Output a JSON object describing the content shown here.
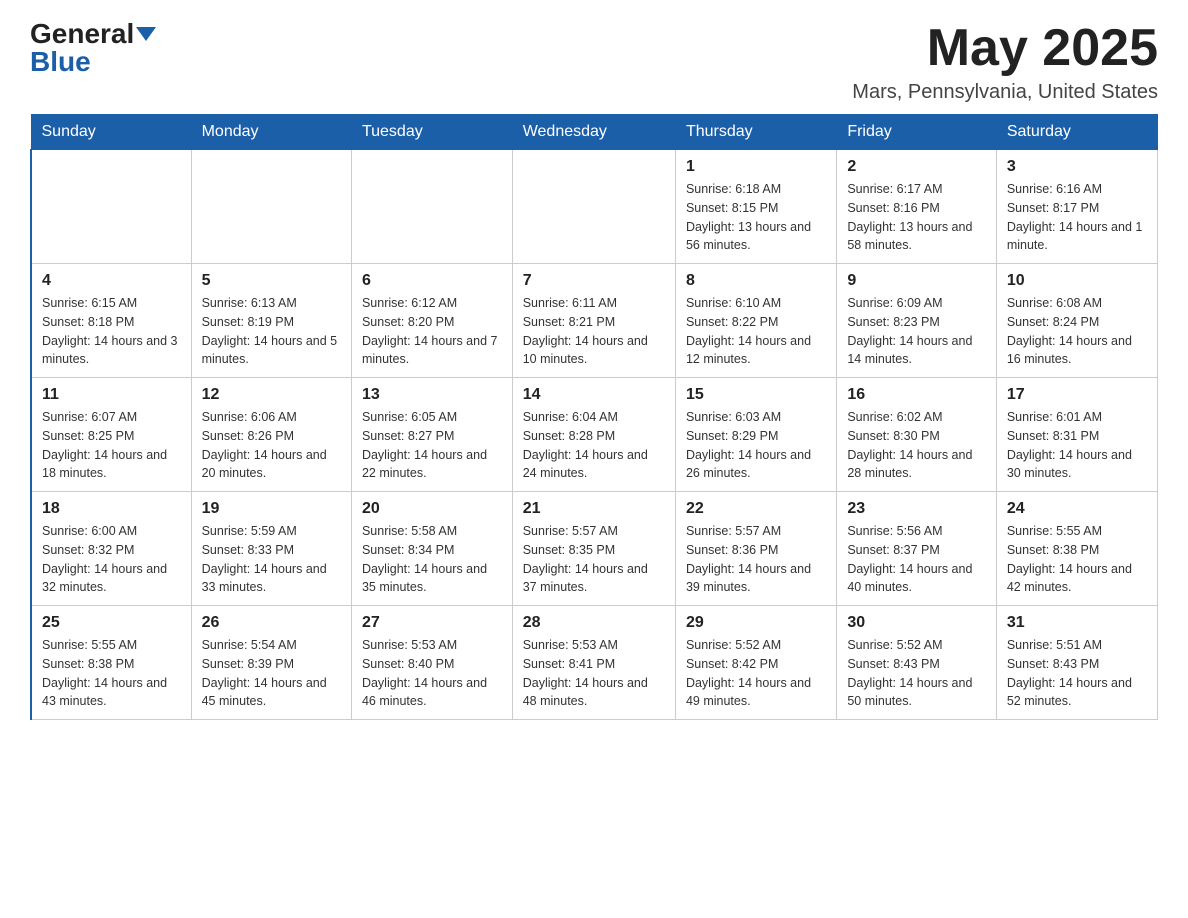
{
  "header": {
    "logo_general": "General",
    "logo_blue": "Blue",
    "title": "May 2025",
    "subtitle": "Mars, Pennsylvania, United States"
  },
  "days_of_week": [
    "Sunday",
    "Monday",
    "Tuesday",
    "Wednesday",
    "Thursday",
    "Friday",
    "Saturday"
  ],
  "weeks": [
    [
      {
        "day": "",
        "info": ""
      },
      {
        "day": "",
        "info": ""
      },
      {
        "day": "",
        "info": ""
      },
      {
        "day": "",
        "info": ""
      },
      {
        "day": "1",
        "info": "Sunrise: 6:18 AM\nSunset: 8:15 PM\nDaylight: 13 hours and 56 minutes."
      },
      {
        "day": "2",
        "info": "Sunrise: 6:17 AM\nSunset: 8:16 PM\nDaylight: 13 hours and 58 minutes."
      },
      {
        "day": "3",
        "info": "Sunrise: 6:16 AM\nSunset: 8:17 PM\nDaylight: 14 hours and 1 minute."
      }
    ],
    [
      {
        "day": "4",
        "info": "Sunrise: 6:15 AM\nSunset: 8:18 PM\nDaylight: 14 hours and 3 minutes."
      },
      {
        "day": "5",
        "info": "Sunrise: 6:13 AM\nSunset: 8:19 PM\nDaylight: 14 hours and 5 minutes."
      },
      {
        "day": "6",
        "info": "Sunrise: 6:12 AM\nSunset: 8:20 PM\nDaylight: 14 hours and 7 minutes."
      },
      {
        "day": "7",
        "info": "Sunrise: 6:11 AM\nSunset: 8:21 PM\nDaylight: 14 hours and 10 minutes."
      },
      {
        "day": "8",
        "info": "Sunrise: 6:10 AM\nSunset: 8:22 PM\nDaylight: 14 hours and 12 minutes."
      },
      {
        "day": "9",
        "info": "Sunrise: 6:09 AM\nSunset: 8:23 PM\nDaylight: 14 hours and 14 minutes."
      },
      {
        "day": "10",
        "info": "Sunrise: 6:08 AM\nSunset: 8:24 PM\nDaylight: 14 hours and 16 minutes."
      }
    ],
    [
      {
        "day": "11",
        "info": "Sunrise: 6:07 AM\nSunset: 8:25 PM\nDaylight: 14 hours and 18 minutes."
      },
      {
        "day": "12",
        "info": "Sunrise: 6:06 AM\nSunset: 8:26 PM\nDaylight: 14 hours and 20 minutes."
      },
      {
        "day": "13",
        "info": "Sunrise: 6:05 AM\nSunset: 8:27 PM\nDaylight: 14 hours and 22 minutes."
      },
      {
        "day": "14",
        "info": "Sunrise: 6:04 AM\nSunset: 8:28 PM\nDaylight: 14 hours and 24 minutes."
      },
      {
        "day": "15",
        "info": "Sunrise: 6:03 AM\nSunset: 8:29 PM\nDaylight: 14 hours and 26 minutes."
      },
      {
        "day": "16",
        "info": "Sunrise: 6:02 AM\nSunset: 8:30 PM\nDaylight: 14 hours and 28 minutes."
      },
      {
        "day": "17",
        "info": "Sunrise: 6:01 AM\nSunset: 8:31 PM\nDaylight: 14 hours and 30 minutes."
      }
    ],
    [
      {
        "day": "18",
        "info": "Sunrise: 6:00 AM\nSunset: 8:32 PM\nDaylight: 14 hours and 32 minutes."
      },
      {
        "day": "19",
        "info": "Sunrise: 5:59 AM\nSunset: 8:33 PM\nDaylight: 14 hours and 33 minutes."
      },
      {
        "day": "20",
        "info": "Sunrise: 5:58 AM\nSunset: 8:34 PM\nDaylight: 14 hours and 35 minutes."
      },
      {
        "day": "21",
        "info": "Sunrise: 5:57 AM\nSunset: 8:35 PM\nDaylight: 14 hours and 37 minutes."
      },
      {
        "day": "22",
        "info": "Sunrise: 5:57 AM\nSunset: 8:36 PM\nDaylight: 14 hours and 39 minutes."
      },
      {
        "day": "23",
        "info": "Sunrise: 5:56 AM\nSunset: 8:37 PM\nDaylight: 14 hours and 40 minutes."
      },
      {
        "day": "24",
        "info": "Sunrise: 5:55 AM\nSunset: 8:38 PM\nDaylight: 14 hours and 42 minutes."
      }
    ],
    [
      {
        "day": "25",
        "info": "Sunrise: 5:55 AM\nSunset: 8:38 PM\nDaylight: 14 hours and 43 minutes."
      },
      {
        "day": "26",
        "info": "Sunrise: 5:54 AM\nSunset: 8:39 PM\nDaylight: 14 hours and 45 minutes."
      },
      {
        "day": "27",
        "info": "Sunrise: 5:53 AM\nSunset: 8:40 PM\nDaylight: 14 hours and 46 minutes."
      },
      {
        "day": "28",
        "info": "Sunrise: 5:53 AM\nSunset: 8:41 PM\nDaylight: 14 hours and 48 minutes."
      },
      {
        "day": "29",
        "info": "Sunrise: 5:52 AM\nSunset: 8:42 PM\nDaylight: 14 hours and 49 minutes."
      },
      {
        "day": "30",
        "info": "Sunrise: 5:52 AM\nSunset: 8:43 PM\nDaylight: 14 hours and 50 minutes."
      },
      {
        "day": "31",
        "info": "Sunrise: 5:51 AM\nSunset: 8:43 PM\nDaylight: 14 hours and 52 minutes."
      }
    ]
  ]
}
